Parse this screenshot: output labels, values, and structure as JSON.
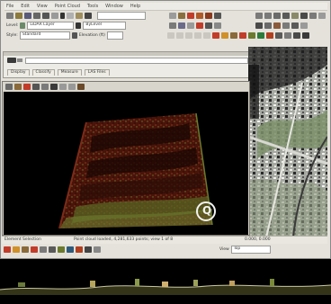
{
  "menu": {
    "items": [
      "File",
      "Edit",
      "View",
      "Point Cloud",
      "Tools",
      "Window",
      "Help"
    ]
  },
  "toolbar": {
    "level_label": "Level:",
    "level_value": "LiDAR Layer",
    "color_value": "ByLevel",
    "style_label": "Style:",
    "style_value": "Standard",
    "elevation_label": "Elevation (ft)"
  },
  "panel": {
    "search_value": "",
    "tabs": [
      "Display",
      "Classify",
      "Measure",
      "LAS Files"
    ]
  },
  "viewport": {
    "logo_text": "Q"
  },
  "statusbar": {
    "left_text": "Element Selection",
    "center_text": "Point cloud loaded, 4,281,633 points; view 1 of 8",
    "coords_text": "0.000, 0.000",
    "view_label": "View",
    "view_value": "Top"
  },
  "colors": {
    "chrome": "#e4e2da",
    "viewport_bg": "#000000",
    "accent_button": "#c23c2a",
    "cloud_dark": "#3a0e08",
    "cloud_mid": "#7d2b18",
    "cloud_green": "#6b7a2e"
  }
}
